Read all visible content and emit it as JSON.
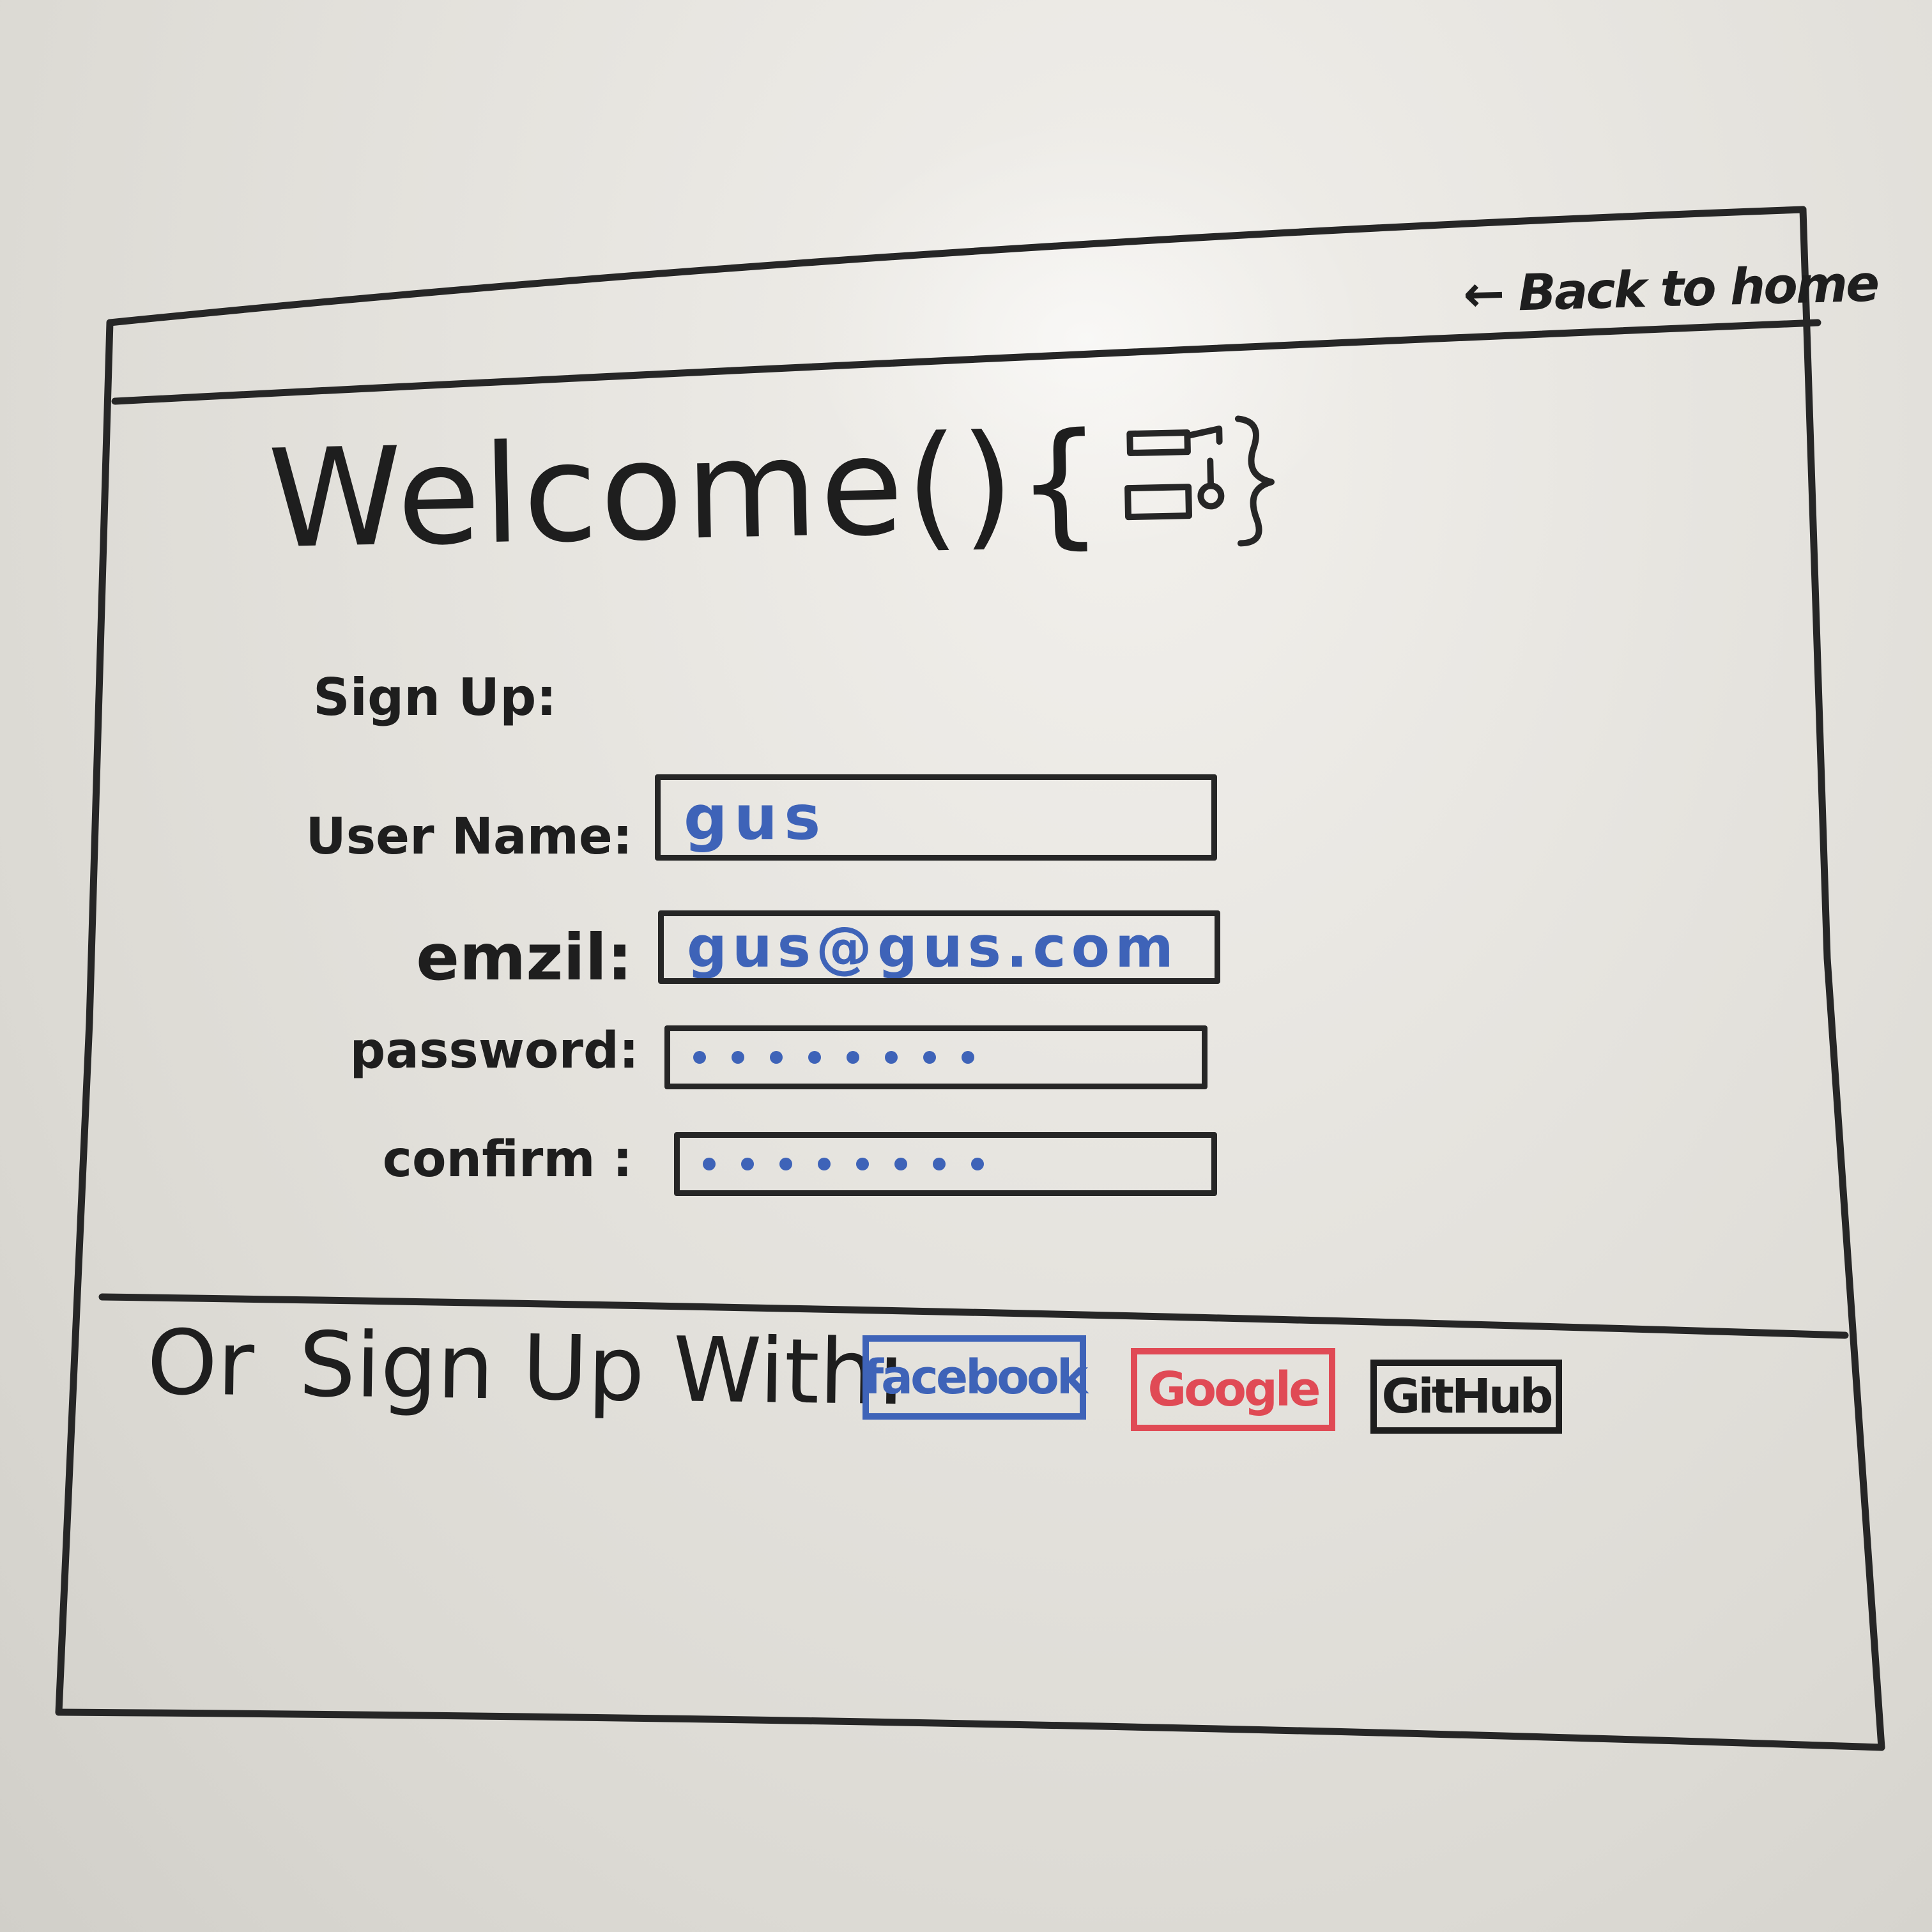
{
  "nav": {
    "back_arrow": "←",
    "back_label": "Back to home"
  },
  "header": {
    "title": "Welcome(){",
    "logo_icon": "code-brace-gadget-icon"
  },
  "form": {
    "heading": "Sign Up:",
    "fields": [
      {
        "label": "User Name:",
        "value": "gus"
      },
      {
        "label": "emzil:",
        "value": "gus@gus.com"
      },
      {
        "label": "password:",
        "masked_count": 8
      },
      {
        "label": "confirm :",
        "masked_count": 8
      }
    ]
  },
  "social": {
    "or_word": "Or",
    "prompt": "Sign Up With:",
    "buttons": [
      {
        "label": "facebook",
        "color": "#3e63b8"
      },
      {
        "label": "Google",
        "color": "#e04a55"
      },
      {
        "label": "GitHub",
        "color": "#1e1e1e"
      }
    ]
  },
  "colors": {
    "ink": "#1e1e1e",
    "blue_marker": "#3e63b8",
    "red_marker": "#e04a55",
    "whiteboard": "#e6e4df"
  }
}
